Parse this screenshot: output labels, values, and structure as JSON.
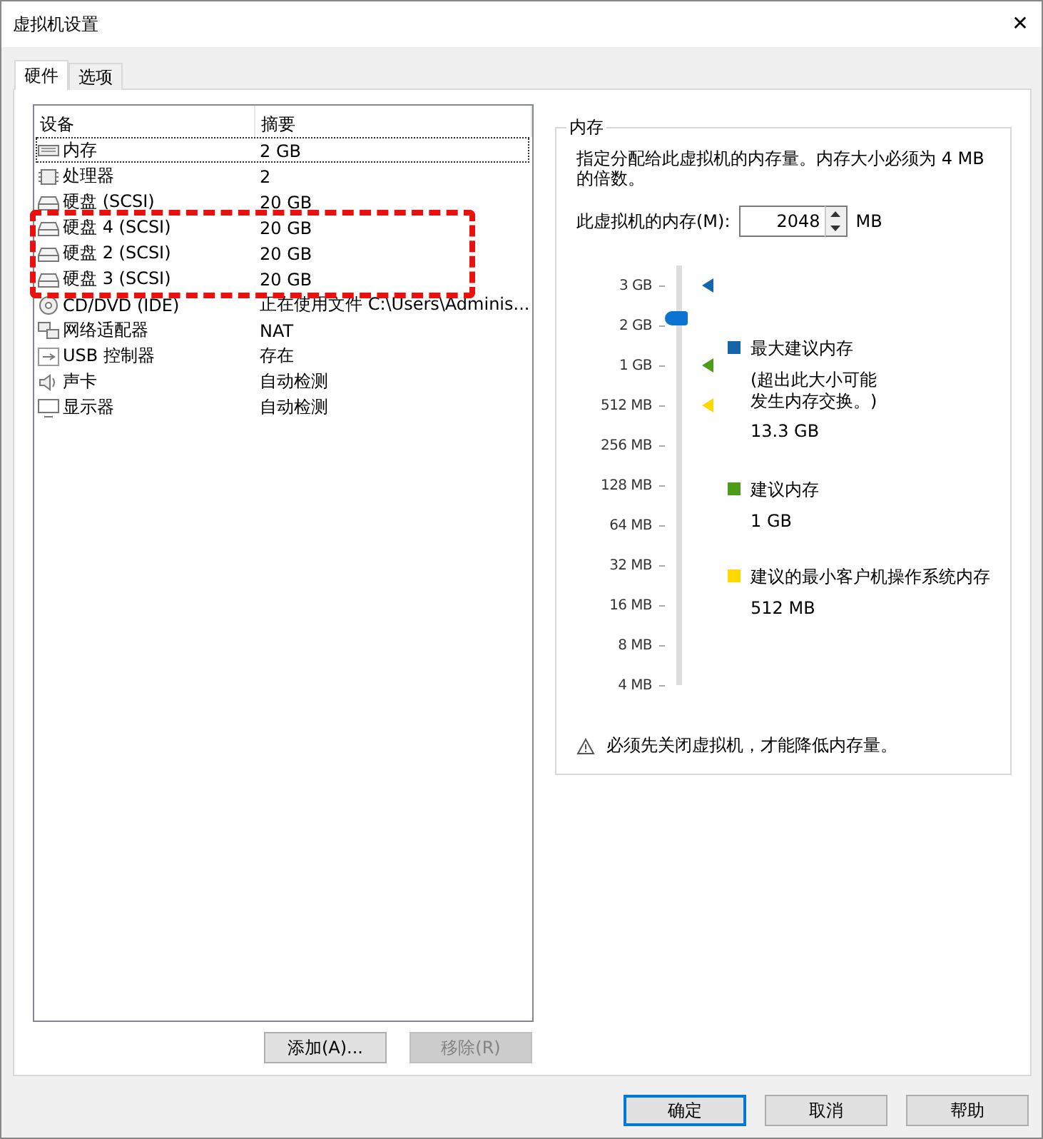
{
  "window": {
    "title": "虚拟机设置",
    "close": "✕"
  },
  "tabs": [
    {
      "label": "硬件",
      "selected": true
    },
    {
      "label": "选项",
      "selected": false
    }
  ],
  "devices": {
    "columns": [
      "设备",
      "摘要"
    ],
    "rows": [
      {
        "kind": "memory",
        "name": "内存",
        "summary": "2 GB",
        "selected": true,
        "highlighted": false
      },
      {
        "kind": "cpu",
        "name": "处理器",
        "summary": "2",
        "selected": false,
        "highlighted": false
      },
      {
        "kind": "disk",
        "name": "硬盘 (SCSI)",
        "summary": "20 GB",
        "selected": false,
        "highlighted": false
      },
      {
        "kind": "disk",
        "name": "硬盘 4 (SCSI)",
        "summary": "20 GB",
        "selected": false,
        "highlighted": true
      },
      {
        "kind": "disk",
        "name": "硬盘 2 (SCSI)",
        "summary": "20 GB",
        "selected": false,
        "highlighted": true
      },
      {
        "kind": "disk",
        "name": "硬盘 3 (SCSI)",
        "summary": "20 GB",
        "selected": false,
        "highlighted": true
      },
      {
        "kind": "cdrom",
        "name": "CD/DVD (IDE)",
        "summary": "正在使用文件 C:\\Users\\Adminis...",
        "selected": false,
        "highlighted": false
      },
      {
        "kind": "network",
        "name": "网络适配器",
        "summary": "NAT",
        "selected": false,
        "highlighted": false
      },
      {
        "kind": "usb",
        "name": "USB 控制器",
        "summary": "存在",
        "selected": false,
        "highlighted": false
      },
      {
        "kind": "sound",
        "name": "声卡",
        "summary": "自动检测",
        "selected": false,
        "highlighted": false
      },
      {
        "kind": "display",
        "name": "显示器",
        "summary": "自动检测",
        "selected": false,
        "highlighted": false
      }
    ],
    "buttons": [
      {
        "label": "添加(A)...",
        "disabled": false
      },
      {
        "label": "移除(R)",
        "disabled": true
      }
    ]
  },
  "memory": {
    "title": "内存",
    "description": "指定分配给此虚拟机的内存量。内存大小必须为 4 MB 的倍数。",
    "field_label": "此虚拟机的内存(M):",
    "value": "2048",
    "unit": "MB",
    "slider": {
      "ticks": [
        {
          "label": "3 GB",
          "color": "#1565a8"
        },
        {
          "label": "2 GB"
        },
        {
          "label": "1 GB",
          "color": "#4e9a1a"
        },
        {
          "label": "512 MB",
          "color": "#ffd800"
        },
        {
          "label": "256 MB"
        },
        {
          "label": "128 MB"
        },
        {
          "label": "64 MB"
        },
        {
          "label": "32 MB"
        },
        {
          "label": "16 MB"
        },
        {
          "label": "8 MB"
        },
        {
          "label": "4 MB"
        }
      ],
      "level": 0.9
    },
    "legend": [
      {
        "color": "#1565a8",
        "title": "最大建议内存",
        "note": "(超出此大小可能发生内存交换。)",
        "value": "13.3 GB"
      },
      {
        "color": "#4e9a1a",
        "title": "建议内存",
        "value": "1 GB"
      },
      {
        "color": "#ffd800",
        "title": "建议的最小客户机操作系统内存",
        "value": "512 MB"
      }
    ],
    "warning": "必须先关闭虚拟机，才能降低内存量。"
  },
  "footer": [
    {
      "label": "确定",
      "default": true
    },
    {
      "label": "取消",
      "default": false
    },
    {
      "label": "帮助",
      "default": false
    }
  ]
}
